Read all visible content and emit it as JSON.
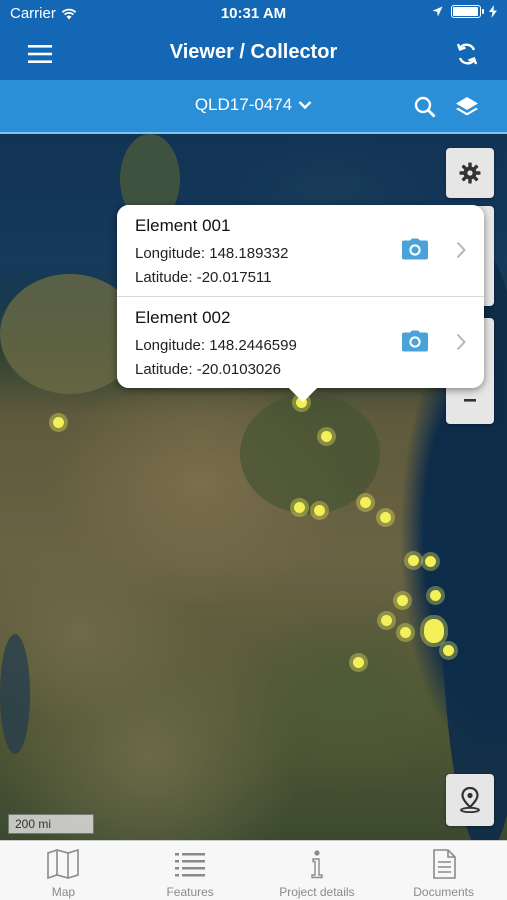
{
  "status_bar": {
    "carrier": "Carrier",
    "time": "10:31 AM",
    "battery_level": 0.9
  },
  "nav": {
    "title": "Viewer / Collector"
  },
  "sub_bar": {
    "project": "QLD17-0474"
  },
  "map": {
    "scale_label": "200 mi"
  },
  "callout": {
    "items": [
      {
        "name": "Element 001",
        "longitude": "Longitude: 148.189332",
        "latitude": "Latitude: -20.017511"
      },
      {
        "name": "Element 002",
        "longitude": "Longitude: 148.2446599",
        "latitude": "Latitude: -20.0103026"
      }
    ]
  },
  "tabs": [
    {
      "label": "Map",
      "icon": "map-icon"
    },
    {
      "label": "Features",
      "icon": "list-icon"
    },
    {
      "label": "Project details",
      "icon": "info-icon"
    },
    {
      "label": "Documents",
      "icon": "document-icon"
    }
  ],
  "colors": {
    "nav": "#1467b4",
    "sub_bar": "#2a8fd6",
    "point": "#f3f05a",
    "camera": "#4aa3d8"
  }
}
